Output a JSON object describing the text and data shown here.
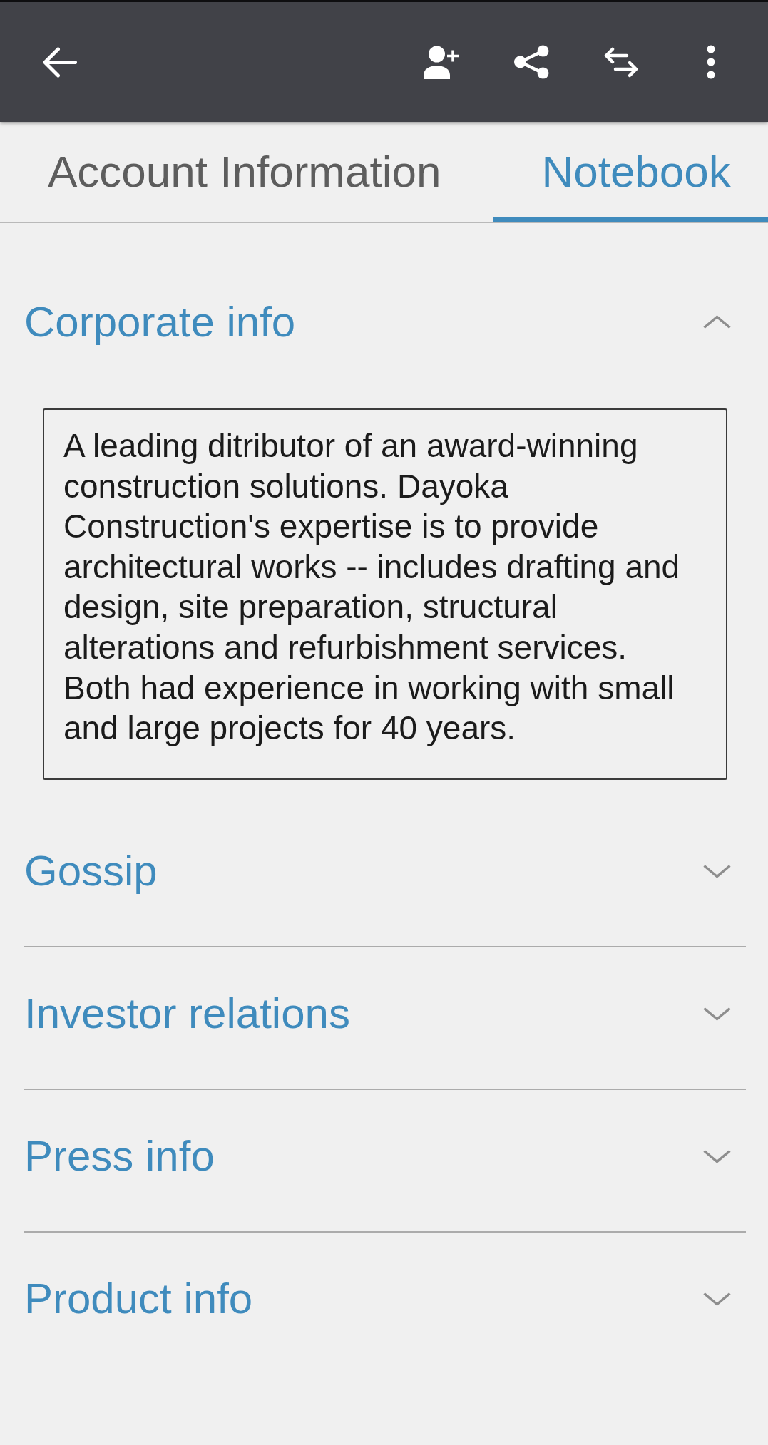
{
  "tabs": [
    {
      "label": "Account Information",
      "selected": false
    },
    {
      "label": "Notebook",
      "selected": true
    }
  ],
  "sections": [
    {
      "title": "Corporate info",
      "expanded": true,
      "body": "A leading ditributor of an award-winning construction solutions. Dayoka Construction's expertise is to provide architectural works -- includes drafting and design, site preparation, structural alterations and refurbishment services. Both had experience in working with small and large projects for 40 years."
    },
    {
      "title": "Gossip",
      "expanded": false
    },
    {
      "title": "Investor relations",
      "expanded": false
    },
    {
      "title": "Press info",
      "expanded": false
    },
    {
      "title": "Product info",
      "expanded": false
    }
  ]
}
